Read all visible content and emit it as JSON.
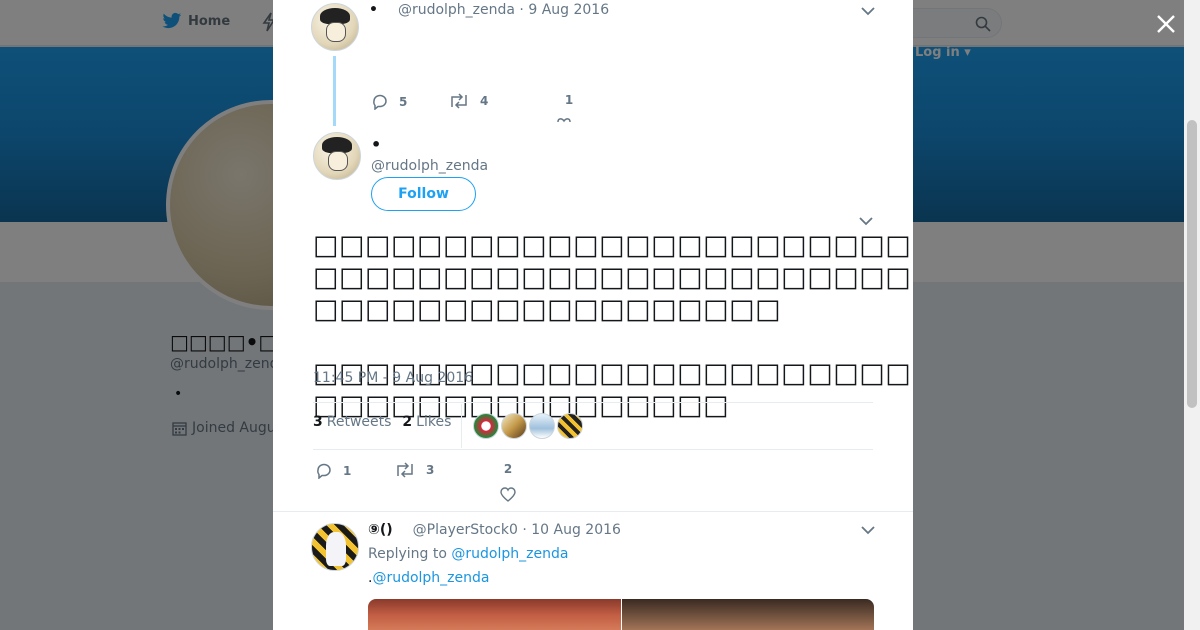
{
  "background": {
    "nav": {
      "home_label": "Home",
      "login_label": "Log in ▾"
    },
    "profile": {
      "name": "□□□□•□□□",
      "handle": "@rudolph_zend",
      "bio": "•",
      "joined": "Joined Augu"
    }
  },
  "thread_parent": {
    "name": "•",
    "handle": "@rudolph_zenda",
    "date": "9 Aug 2016",
    "replies": "5",
    "retweets": "4",
    "likes": "1"
  },
  "main_tweet": {
    "name": "•",
    "handle": "@rudolph_zenda",
    "follow_label": "Follow",
    "text": "□□□□□□□□□□□□□□□□□□□□□□□□□□□□□□□□□□□□□□□□□□□□□□□□□□□□□□□□□□□□□□□□□□□□□□□□□□□□□□□□□□\n\n□□□□□□□□□□□□□□□□□□□□□□□□□□□□□□□□□□□□□□□□□□□□□□□□",
    "timestamp": "11:45 PM - 9 Aug 2016",
    "retweets_count": "3",
    "retweets_label": "Retweets",
    "likes_count": "2",
    "likes_label": "Likes",
    "action_replies": "1",
    "action_retweets": "3",
    "action_likes": "2"
  },
  "reply": {
    "name": "⑨()",
    "handle": "@PlayerStock0",
    "date": "10 Aug 2016",
    "replying_to_prefix": "Replying to ",
    "replying_to_handle": "@rudolph_zenda",
    "text_prefix": ".",
    "text_mention": "@rudolph_zenda"
  },
  "colors": {
    "accent": "#1da1f2",
    "link": "#1b95e0",
    "thread_line": "#a4d9f9"
  }
}
